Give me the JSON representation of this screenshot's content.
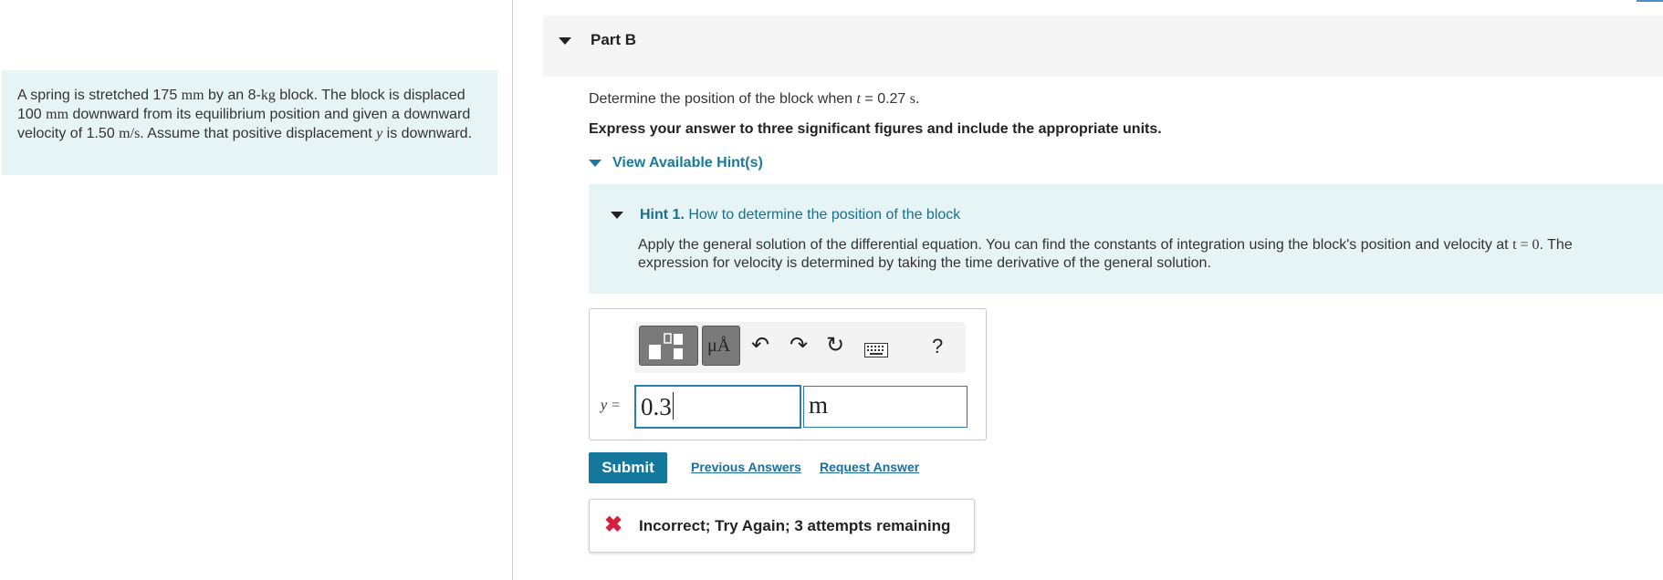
{
  "problem": {
    "p1": "A spring is stretched 175 ",
    "u1": "mm",
    "p2": " by an 8-",
    "u2": "kg",
    "p3": " block. The block is displaced 100 ",
    "u3": "mm",
    "p4": " downward from its equilibrium position and given a downward velocity of 1.50 ",
    "u4": "m/s",
    "p5": ". Assume that positive displacement ",
    "v1": "y",
    "p6": " is downward."
  },
  "part": {
    "title": "Part B"
  },
  "question": {
    "pre": "Determine the position of the block when ",
    "var": "t",
    "mid": " = 0.27 ",
    "unit": "s",
    "post": "."
  },
  "instruction": "Express your answer to three significant figures and include the appropriate units.",
  "hints": {
    "toggle_label": "View Available Hint(s)",
    "hint1": {
      "number": "Hint 1.",
      "title": " How to determine the position of the block",
      "body_pre": "Apply the general solution of the differential equation. You can find the constants of integration using the block's position and velocity at ",
      "body_math": "t = 0",
      "body_post": ". The expression for velocity is determined by taking the time derivative of the general solution."
    }
  },
  "answer": {
    "label": "y =",
    "value": "0.3",
    "units": "m",
    "toolbar": {
      "symbols_label": "μÅ",
      "undo_glyph": "↶",
      "redo_glyph": "↷",
      "reset_glyph": "↻",
      "keyboard_glyph": "⌨",
      "help_label": "?"
    }
  },
  "actions": {
    "submit": "Submit",
    "previous_answers": "Previous Answers",
    "request_answer": "Request Answer"
  },
  "feedback": {
    "icon": "✖",
    "text": "Incorrect; Try Again; 3 attempts remaining",
    "color": "#d4203d"
  }
}
